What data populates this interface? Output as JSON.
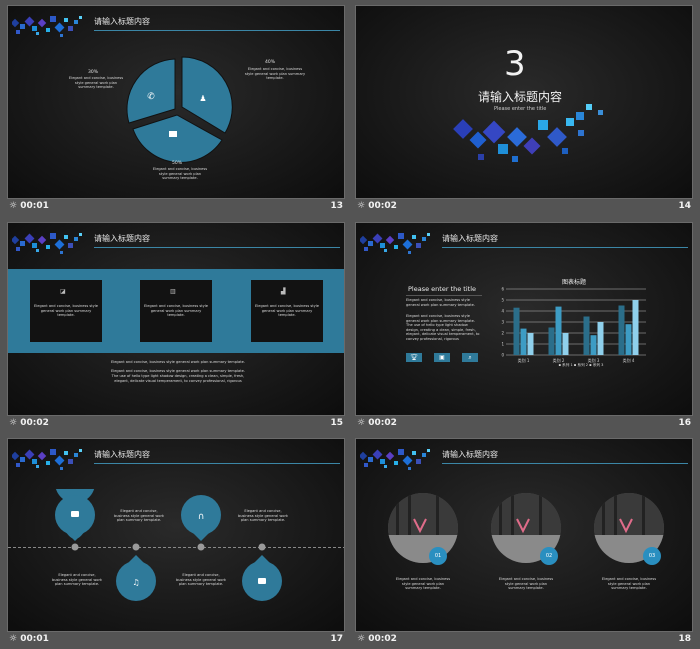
{
  "slide_title": "请输入标题内容",
  "body_short": "Elegant and concise, business style general work plan summary template.",
  "slides": [
    {
      "time": "00:01",
      "number": "13",
      "pie": {
        "labels": [
          "30%",
          "40%",
          "50%"
        ],
        "values": [
          30,
          40,
          50
        ]
      }
    },
    {
      "time": "00:02",
      "number": "14",
      "section_number": "3",
      "section_title": "请输入标题内容",
      "section_subtitle": "Please enter the title"
    },
    {
      "time": "00:02",
      "number": "15",
      "bottom_line1": "Elegant and concise, business style general work plan summary template.",
      "bottom_line2": "Elegant and concise, business style general work plan summary template.",
      "bottom_line3": "The use of hello type light shadow design, creating a clean, simple, fresh,",
      "bottom_line4": "elegant, delicate visual temperament, to convey professional, rigorous"
    },
    {
      "time": "00:02",
      "number": "16",
      "heading": "Please enter the title",
      "para1": "Elegant and concise, business style general work plan summary template.",
      "para2": "Elegant and concise, business style general work plan summary template. The use of hello type light shadow design, creating a clean, simple, fresh, elegant, delicate visual temperament, to convey professional, rigorous",
      "chart_title": "图表标题",
      "legend": "▪ 系列 1  ▪ 系列 2  ▪ 系列 3"
    },
    {
      "time": "00:01",
      "number": "17"
    },
    {
      "time": "00:02",
      "number": "18",
      "badges": [
        "01",
        "02",
        "03"
      ]
    }
  ],
  "chart_data": {
    "type": "bar",
    "title": "图表标题",
    "categories": [
      "类别 1",
      "类别 2",
      "类别 3",
      "类别 4"
    ],
    "series": [
      {
        "name": "系列 1",
        "values": [
          4.3,
          2.5,
          3.5,
          4.5
        ]
      },
      {
        "name": "系列 2",
        "values": [
          2.4,
          4.4,
          1.8,
          2.8
        ]
      },
      {
        "name": "系列 3",
        "values": [
          2,
          2,
          3,
          5
        ]
      }
    ],
    "ylim": [
      0,
      6
    ],
    "yticks": [
      "0",
      "1",
      "2",
      "3",
      "4",
      "5",
      "6"
    ],
    "colors": [
      "#2b6e8a",
      "#3d9cc4",
      "#8fd0ec"
    ],
    "grid": true,
    "legend_position": "bottom"
  },
  "colors": {
    "accent": "#3b86a6",
    "deep_blue": "#2b6e8a"
  }
}
